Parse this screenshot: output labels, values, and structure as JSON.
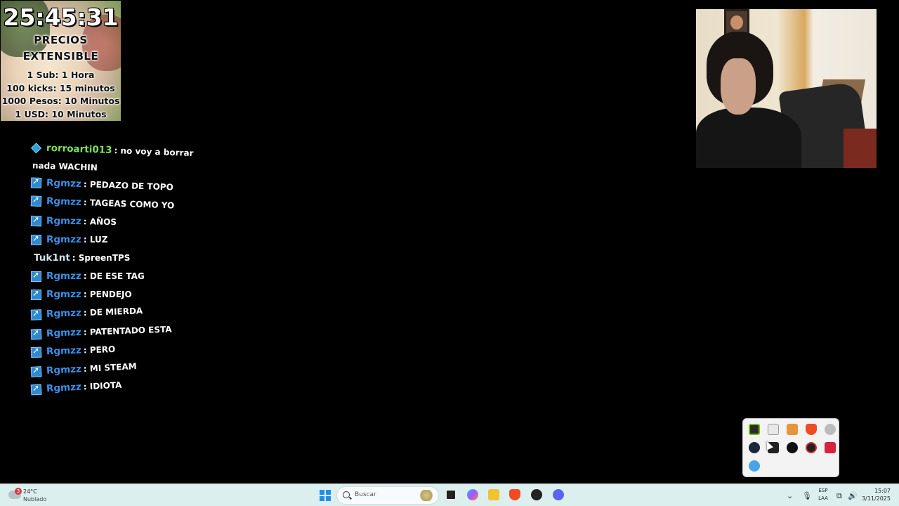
{
  "timer": {
    "time": "25:45:31",
    "heading1": "PRECIOS",
    "heading2": "EXTENSIBLE",
    "rates": [
      "1 Sub: 1 Hora",
      "100 kicks: 15 minutos",
      "1000 Pesos: 10 Minutos",
      "1 USD: 10 Minutos"
    ]
  },
  "chat": {
    "messages": [
      {
        "user": "rorroarti013",
        "text": ": no voy a borrar",
        "continuation": "nada WACHIN"
      },
      {
        "user": "Rgmzz",
        "text": ": PEDAZO DE TOPO"
      },
      {
        "user": "Rgmzz",
        "text": ": TAGEAS COMO YO"
      },
      {
        "user": "Rgmzz",
        "text": ": AÑOS"
      },
      {
        "user": "Rgmzz",
        "text": ": LUZ"
      },
      {
        "user": "Tuk1nt",
        "text": ": SpreenTPS"
      },
      {
        "user": "Rgmzz",
        "text": ": DE ESE TAG"
      },
      {
        "user": "Rgmzz",
        "text": ": PENDEJO"
      },
      {
        "user": "Rgmzz",
        "text": ": DE MIERDA"
      },
      {
        "user": "Rgmzz",
        "text": ": PATENTADO ESTA"
      },
      {
        "user": "Rgmzz",
        "text": ": PERO"
      },
      {
        "user": "Rgmzz",
        "text": ": MI STEAM"
      },
      {
        "user": "Rgmzz",
        "text": ": IDIOTA"
      }
    ]
  },
  "taskbar": {
    "weather": {
      "temp": "24°C",
      "desc": "Nublado",
      "alert_count": "3"
    },
    "search_placeholder": "Buscar",
    "language": {
      "line1": "ESP",
      "line2": "LAA"
    },
    "clock": {
      "time": "15:07",
      "date": "3/11/2025"
    },
    "chevron": "⌄",
    "icons": {
      "mic": "🎙",
      "network": "⧉",
      "volume": "🔊"
    }
  },
  "tray_icons": [
    "nvidia-icon",
    "discord-icon",
    "app-orange-icon",
    "brave-icon",
    "hidden-eye-icon",
    "steam-icon",
    "audio-mixer-icon",
    "obs-like-icon",
    "record-icon",
    "red-app-icon",
    "defender-icon"
  ],
  "colors": {
    "taskbar": "#dcefef",
    "username_blue": "#3d8fe6",
    "username_green": "#7ee05a",
    "accent": "#1e90e6"
  }
}
